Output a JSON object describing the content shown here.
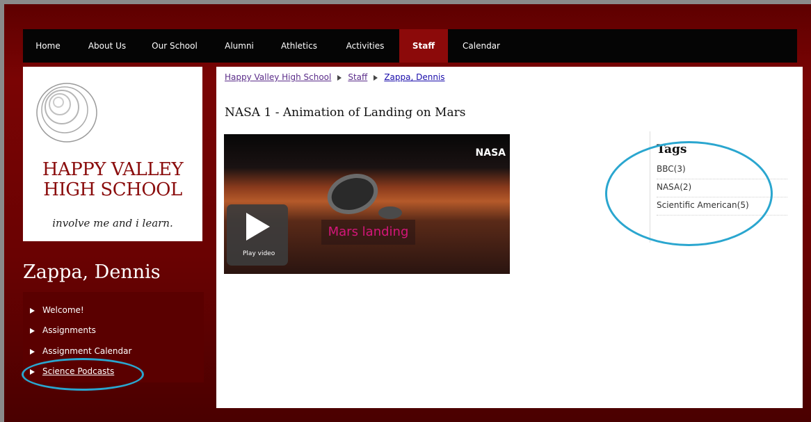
{
  "nav": {
    "items": [
      {
        "label": "Home"
      },
      {
        "label": "About Us"
      },
      {
        "label": "Our School"
      },
      {
        "label": "Alumni"
      },
      {
        "label": "Athletics"
      },
      {
        "label": "Activities"
      },
      {
        "label": "Staff",
        "active": true
      },
      {
        "label": "Calendar"
      }
    ]
  },
  "school": {
    "name_line1": "HAPPY VALLEY",
    "name_line2": "HIGH SCHOOL",
    "motto": "involve me and i learn."
  },
  "teacher": {
    "name": "Zappa, Dennis",
    "menu": [
      {
        "label": "Welcome!"
      },
      {
        "label": "Assignments"
      },
      {
        "label": "Assignment Calendar"
      },
      {
        "label": "Science Podcasts",
        "underlined": true
      }
    ]
  },
  "breadcrumb": {
    "items": [
      "Happy Valley High School",
      "Staff",
      "Zappa, Dennis"
    ]
  },
  "page": {
    "title": "NASA 1 - Animation of Landing on Mars"
  },
  "video": {
    "brand": "NASA",
    "overlay_text": "Mars landing",
    "play_label": "Play video"
  },
  "tags": {
    "title": "Tags",
    "items": [
      "BBC(3)",
      "NASA(2)",
      "Scientific American(5)"
    ]
  },
  "colors": {
    "accent": "#8c0a0a",
    "highlight_ellipse": "#2aa6cf",
    "link": "#5b2d8a"
  }
}
